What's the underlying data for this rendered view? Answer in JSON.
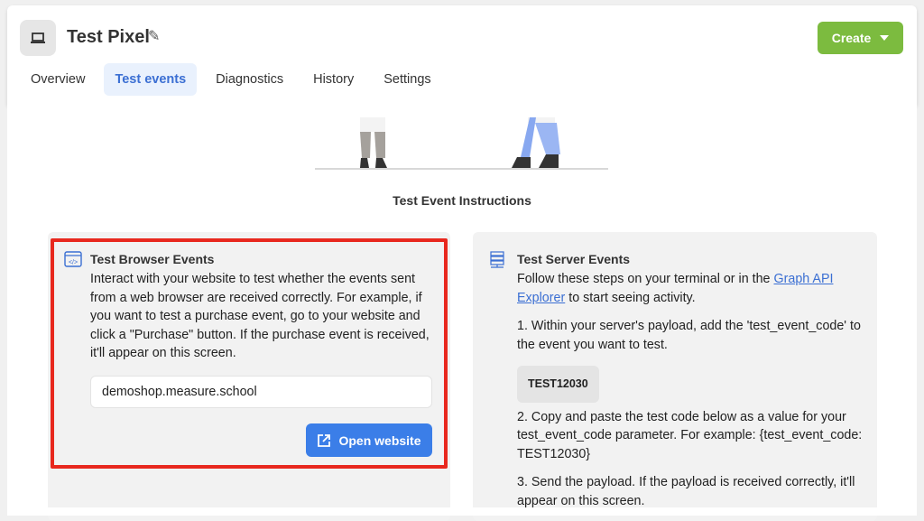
{
  "header": {
    "title": "Test Pixel",
    "create_label": "Create",
    "tabs": [
      {
        "label": "Overview"
      },
      {
        "label": "Test events"
      },
      {
        "label": "Diagnostics"
      },
      {
        "label": "History"
      },
      {
        "label": "Settings"
      }
    ],
    "active_tab": "Test events"
  },
  "main": {
    "instructions_title": "Test Event Instructions",
    "browser": {
      "title": "Test Browser Events",
      "text": "Interact with your website to test whether the events sent from a web browser are received correctly. For example, if you want to test a purchase event, go to your website and click a \"Purchase\" button. If the purchase event is received, it'll appear on this screen.",
      "url_value": "demoshop.measure.school",
      "open_label": "Open website"
    },
    "server": {
      "title": "Test Server Events",
      "intro_before": "Follow these steps on your terminal or in the ",
      "link": "Graph API Explorer",
      "intro_after": " to start seeing activity.",
      "step1": "1. Within your server's payload, add the 'test_event_code' to the event you want to test.",
      "code": "TEST12030",
      "step2": "2. Copy and paste the test code below as a value for your test_event_code parameter. For example: {test_event_code: TEST12030}",
      "step3": "3. Send the payload. If the payload is received correctly, it'll appear on this screen."
    }
  },
  "colors": {
    "create": "#7cbb3f",
    "primary": "#3b7ee8",
    "highlight": "#e8281e",
    "active_tab_bg": "#e9f1fd"
  }
}
